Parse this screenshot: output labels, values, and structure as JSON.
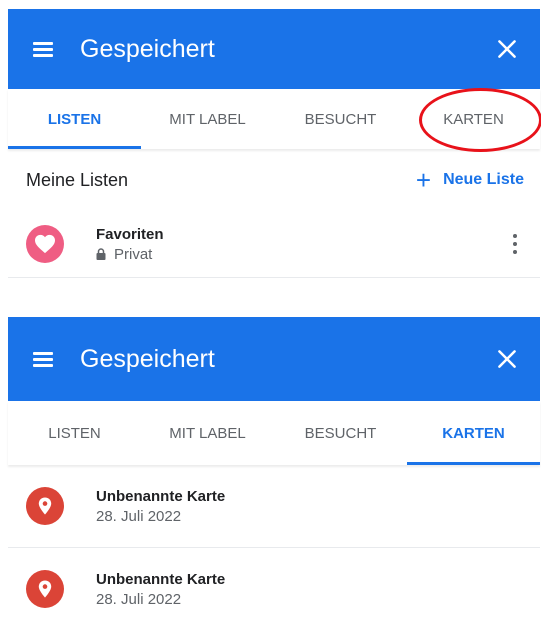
{
  "colors": {
    "primary": "#1a73e8",
    "favorite": "#ef5d83",
    "map": "#db4437",
    "highlight": "#e8121a"
  },
  "top": {
    "appbar": {
      "title": "Gespeichert",
      "menu_icon": "menu-icon",
      "close_icon": "close-icon"
    },
    "tabs": [
      "LISTEN",
      "MIT LABEL",
      "BESUCHT",
      "KARTEN"
    ],
    "active_tab": "LISTEN",
    "highlighted_tab": "KARTEN",
    "section_title": "Meine Listen",
    "new_list_label": "Neue Liste",
    "list": {
      "title": "Favoriten",
      "privacy": "Privat",
      "icon": "heart-icon"
    }
  },
  "bottom": {
    "appbar": {
      "title": "Gespeichert",
      "menu_icon": "menu-icon",
      "close_icon": "close-icon"
    },
    "tabs": [
      "LISTEN",
      "MIT LABEL",
      "BESUCHT",
      "KARTEN"
    ],
    "active_tab": "KARTEN",
    "maps": [
      {
        "title": "Unbenannte Karte",
        "date": "28. Juli 2022",
        "icon": "map-pin-icon"
      },
      {
        "title": "Unbenannte Karte",
        "date": "28. Juli 2022",
        "icon": "map-pin-icon"
      }
    ]
  }
}
